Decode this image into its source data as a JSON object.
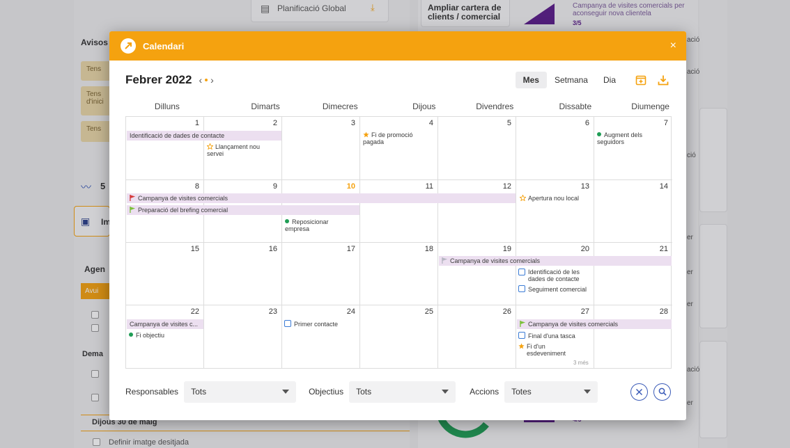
{
  "background": {
    "card1_label": "Planificació Global",
    "card2_label": "Ampliar cartera de clients / comercial",
    "card3_text": "Campanya de visites comercials per aconseguir nova clientela",
    "card3_count": "3/5",
    "avisos_title": "Avisos",
    "aviso1": "Tens",
    "aviso2": "Tens d'inici",
    "aviso3": "Tens",
    "counter": "5",
    "print_label": "Im",
    "agenda_title": "Agen",
    "agenda_tab": "Avui",
    "dema": "Dema",
    "dijous": "Dijous 30 de maig",
    "task": "Definir imatge desitjada",
    "right_snips": [
      "ació",
      "ació",
      "ció",
      "er",
      "er",
      "er",
      "ació",
      "er"
    ],
    "mini_count": "4/5"
  },
  "modal": {
    "title": "Calendari",
    "close": "×",
    "month": "Febrer 2022",
    "prev": "‹",
    "next": "›",
    "views": [
      "Mes",
      "Setmana",
      "Dia"
    ],
    "active_view": "Mes"
  },
  "weekdays": [
    "Dilluns",
    "Dimarts",
    "Dimecres",
    "Dijous",
    "Divendres",
    "Dissabte",
    "Diumenge"
  ],
  "days": [
    [
      "1",
      "2",
      "3",
      "4",
      "5",
      "6",
      "7"
    ],
    [
      "8",
      "9",
      "10",
      "11",
      "12",
      "13",
      "14"
    ],
    [
      "15",
      "16",
      "17",
      "18",
      "19",
      "20",
      "21"
    ],
    [
      "22",
      "23",
      "24",
      "25",
      "26",
      "27",
      "28"
    ]
  ],
  "today": "10",
  "events": {
    "w1_bar": "Identificació de dades de contacte",
    "w1_launch": "Llançament nou servei",
    "w1_promo": "Fi de promoció pagada",
    "w1_seguidors": "Augment dels seguidors",
    "w2_bar1": "Campanya de visites comercials",
    "w2_apertura": "Apertura nou local",
    "w2_bar2": "Preparació del brefing comercial",
    "w2_reposicionar": "Reposicionar empresa",
    "w3_bar": "Campanya de visites comercials",
    "w3_ident": "Identificació de les dades de contacte",
    "w3_seguiment": "Seguiment comercial",
    "w4_bar1": "Campanya de visites c...",
    "w4_fi_objectiu": "Fi objectiu",
    "w4_primer": "Primer contacte",
    "w4_bar2": "Campanya de visites comercials",
    "w4_final": "Final d'una tasca",
    "w4_fi_esdev": "Fi d'un esdeveniment",
    "w4_more": "3 més"
  },
  "filters": {
    "responsables_label": "Responsables",
    "responsables_value": "Tots",
    "objectius_label": "Objectius",
    "objectius_value": "Tots",
    "accions_label": "Accions",
    "accions_value": "Totes"
  },
  "colors": {
    "accent": "#f5a20f",
    "event_bar": "#ecdff0",
    "green": "#1f9d55",
    "red_flag": "#d63b3b",
    "green_flag": "#7cc13a",
    "grey_flag": "#b6b6c2",
    "blue_task": "#3a7bd5"
  }
}
